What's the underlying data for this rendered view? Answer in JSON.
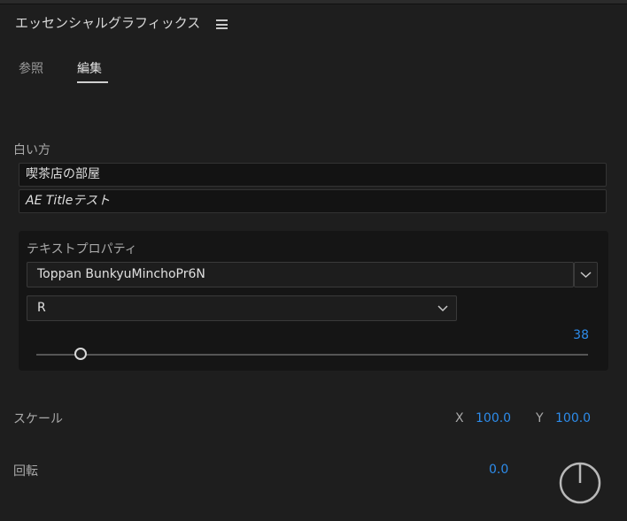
{
  "panel": {
    "title": "エッセンシャルグラフィックス",
    "menu_icon": "hamburger-menu-icon"
  },
  "tabs": [
    {
      "label": "参照",
      "active": false
    },
    {
      "label": "編集",
      "active": true
    }
  ],
  "layer_group": {
    "label": "白い方",
    "text_layers": [
      "喫茶店の部屋",
      "AE Titleテスト"
    ]
  },
  "text_properties": {
    "label": "テキストプロパティ",
    "font_family": "Toppan BunkyuMinchoPr6N",
    "font_style": "R",
    "font_size": "38",
    "font_size_slider_fraction": 0.08
  },
  "scale": {
    "label": "スケール",
    "x_label": "X",
    "x_value": "100.0",
    "y_label": "Y",
    "y_value": "100.0"
  },
  "rotation": {
    "label": "回転",
    "value": "0.0"
  },
  "colors": {
    "accent": "#2d8ceb",
    "background": "#1e1e1e",
    "field": "#131313"
  }
}
